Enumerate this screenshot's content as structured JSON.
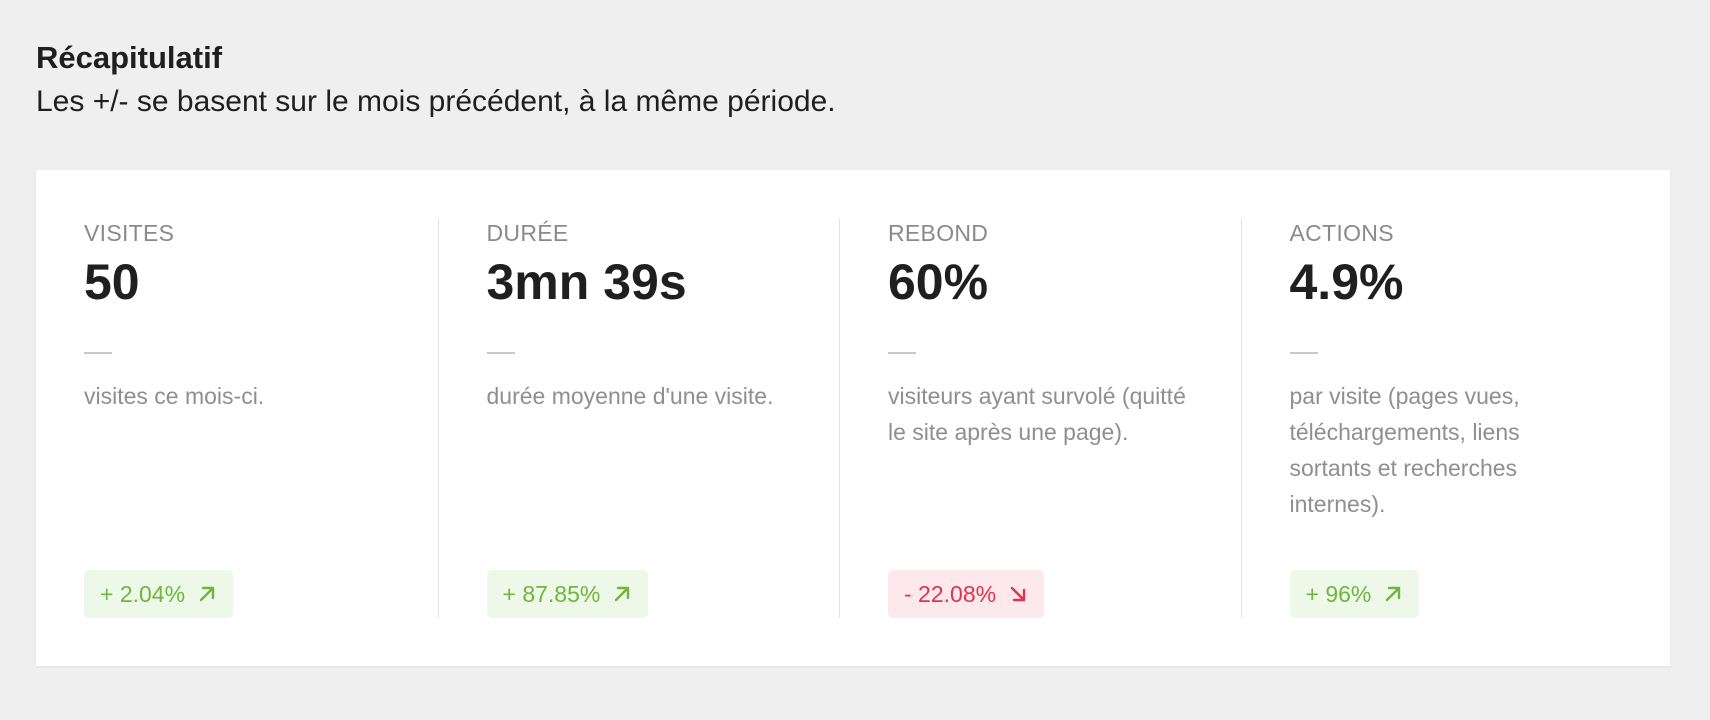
{
  "header": {
    "title": "Récapitulatif",
    "subtitle": "Les +/- se basent sur le mois précédent, à la même période."
  },
  "colors": {
    "positive": "#6fb53e",
    "positive_bg": "#eef8e8",
    "negative": "#e0334f",
    "negative_bg": "#fde8ec"
  },
  "metrics": [
    {
      "label": "VISITES",
      "value": "50",
      "dash": "—",
      "description": "visites ce mois-ci.",
      "change": "+ 2.04%",
      "trend_icon": "arrow-up-right-icon"
    },
    {
      "label": "DURÉE",
      "value": "3mn 39s",
      "dash": "—",
      "description": "durée moyenne d'une visite.",
      "change": "+ 87.85%",
      "trend_icon": "arrow-up-right-icon"
    },
    {
      "label": "REBOND",
      "value": "60%",
      "dash": "—",
      "description": "visiteurs ayant survolé (quitté le site après une page).",
      "change": "- 22.08%",
      "trend_icon": "arrow-down-right-icon"
    },
    {
      "label": "ACTIONS",
      "value": "4.9%",
      "dash": "—",
      "description": "par visite (pages vues, téléchargements, liens sortants et recherches internes).",
      "change": "+ 96%",
      "trend_icon": "arrow-up-right-icon"
    }
  ]
}
